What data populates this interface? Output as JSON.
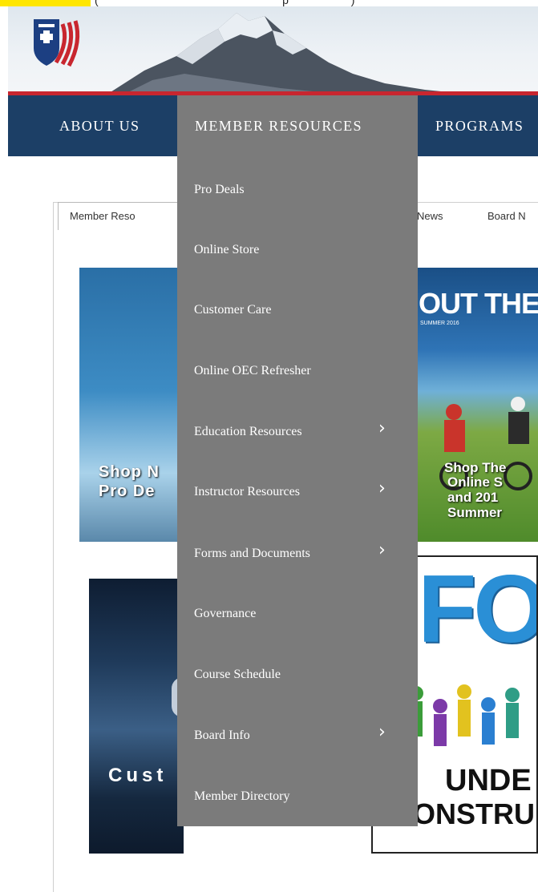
{
  "top_strip": {
    "fragment": "(                                                           p                    )"
  },
  "nav": {
    "items": [
      {
        "label": "ABOUT US"
      },
      {
        "label": "MEMBER RESOURCES"
      },
      {
        "label": "PROGRAMS"
      }
    ]
  },
  "tabs": [
    {
      "label": "Member Reso"
    },
    {
      "label": "News"
    },
    {
      "label": "Board N"
    }
  ],
  "dropdown": {
    "items": [
      {
        "label": "Pro Deals",
        "has_submenu": false
      },
      {
        "label": "Online Store",
        "has_submenu": false
      },
      {
        "label": "Customer Care",
        "has_submenu": false
      },
      {
        "label": "Online OEC Refresher",
        "has_submenu": false
      },
      {
        "label": "Education Resources",
        "has_submenu": true
      },
      {
        "label": "Instructor Resources",
        "has_submenu": true
      },
      {
        "label": "Forms and Documents",
        "has_submenu": true
      },
      {
        "label": "Governance",
        "has_submenu": false
      },
      {
        "label": "Course Schedule",
        "has_submenu": false
      },
      {
        "label": "Board Info",
        "has_submenu": true
      },
      {
        "label": "Member Directory",
        "has_submenu": false
      }
    ],
    "chevron": "›"
  },
  "tiles": {
    "pro_deals": {
      "line1": "Shop N",
      "line2": "Pro De"
    },
    "online_store": {
      "headline": "OUT THERE",
      "season": "SUMMER 2016",
      "line1": "Shop The",
      "line2": "Online S",
      "line3": "and 201",
      "line4": "Summer"
    },
    "customer_care": {
      "text": "Cust"
    },
    "forms": {
      "big": "FOI",
      "line1": "UNDE",
      "line2": "ONSTRU"
    }
  },
  "colors": {
    "nav_bg": "#1c3f66",
    "dropdown_bg": "#7b7b7b",
    "accent_red": "#c8262f",
    "highlight": "#ffe600"
  }
}
